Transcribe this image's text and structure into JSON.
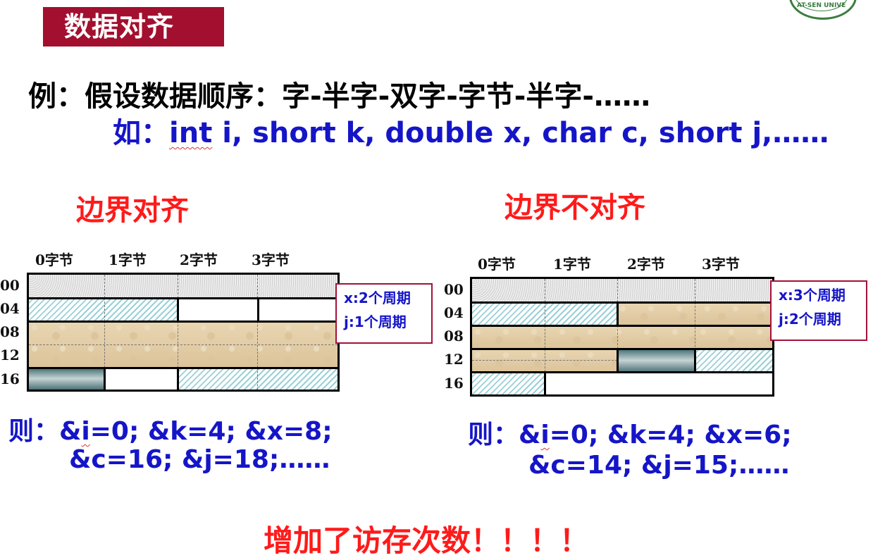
{
  "title": "数据对齐",
  "logo_text": "AT-SEN UNIVE",
  "example": {
    "line1": "例：假设数据顺序：字-半字-双字-字节-半字-……",
    "line2_prefix": "如：",
    "line2_int": "int",
    "line2_rest": " i, short k, double x, char c, short j,……"
  },
  "panels": {
    "aligned": {
      "heading": "边界对齐",
      "columns": [
        "0字节",
        "1字节",
        "2字节",
        "3字节"
      ],
      "rows": [
        "00",
        "04",
        "08",
        "12",
        "16"
      ],
      "note": [
        "x:2个周期",
        "j:1个周期"
      ],
      "address_line1_prefix": "则：&",
      "address_line1_i": "i",
      "address_line1_rest": "=0; &k=4; &x=8;",
      "address_line2": "&c=16; &j=18;……"
    },
    "unaligned": {
      "heading": "边界不对齐",
      "columns": [
        "0字节",
        "1字节",
        "2字节",
        "3字节"
      ],
      "rows": [
        "00",
        "04",
        "08",
        "12",
        "16"
      ],
      "note": [
        "x:3个周期",
        "j:2个周期"
      ],
      "address_line1_prefix": "则：&",
      "address_line1_i": "i",
      "address_line1_rest": "=0; &k=4; &x=6;",
      "address_line2": "&c=14; &j=15;……"
    }
  },
  "conclusion": "增加了访存次数！！！！",
  "colors": {
    "title_bg": "#a30f2e",
    "heading_red": "#ff1a1a",
    "code_blue": "#1515c8"
  }
}
